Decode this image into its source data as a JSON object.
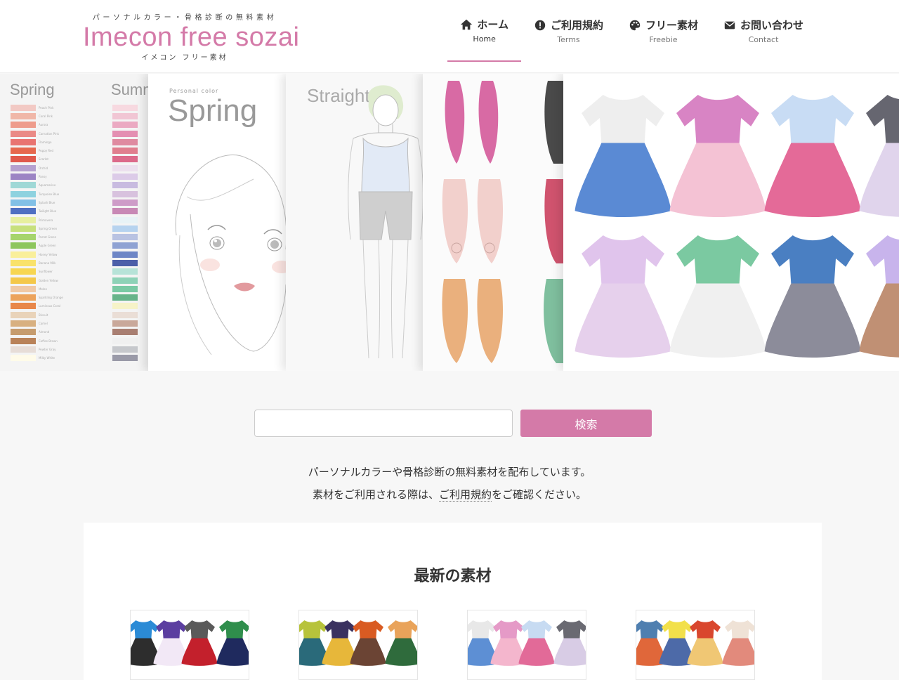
{
  "header": {
    "logo": {
      "tagline": "パーソナルカラー・骨格診断の無料素材",
      "title": "Imecon free sozai",
      "subtitle": "イメコン フリー素材"
    },
    "nav": [
      {
        "label": "ホーム",
        "sub": "Home",
        "icon": "home-icon",
        "active": true
      },
      {
        "label": "ご利用規約",
        "sub": "Terms",
        "icon": "exclamation-circle-icon",
        "active": false
      },
      {
        "label": "フリー素材",
        "sub": "Freebie",
        "icon": "palette-icon",
        "active": false
      },
      {
        "label": "お問い合わせ",
        "sub": "Contact",
        "icon": "envelope-icon",
        "active": false
      }
    ]
  },
  "hero": {
    "swatch_titles": [
      "Spring",
      "Summ"
    ],
    "spring_swatches": [
      "#f2c9c4",
      "#f0b7a8",
      "#ee9c8c",
      "#ea8a86",
      "#e97471",
      "#e6684e",
      "#e0594c",
      "#b5a0cf",
      "#9c84c4",
      "#9fd8d6",
      "#8ed2df",
      "#82c0e6",
      "#4f6fc2",
      "#e7ef9f",
      "#c7e07c",
      "#a6d46c",
      "#8dc65d",
      "#f9ef9a",
      "#f9e26b",
      "#f7d651",
      "#f4c84a",
      "#f0c9a6",
      "#eca35c",
      "#e8874a",
      "#e9d3b9",
      "#d8b080",
      "#c69c6e",
      "#b98258",
      "#e7ddd7",
      "#fffbe9"
    ],
    "spring_labels": [
      "Peach Pink",
      "Coral Pink",
      "Aurora",
      "Carnation Pink",
      "Flamingo",
      "Poppy Red",
      "Scarlet",
      "Orchid",
      "Pansy",
      "Aquamarine",
      "Turquoise Blue",
      "Splash Blue",
      "Twilight Blue",
      "Primavera",
      "Spring Green",
      "Parrot Green",
      "Apple Green",
      "Honey Yellow",
      "Banana Milk",
      "Sunflower",
      "Golden Yellow",
      "Melon",
      "Sparkling Orange",
      "Luminous Coral",
      "Biscuit",
      "Camel",
      "Almond",
      "Coffee Brown",
      "Pewter Gray",
      "Milky White"
    ],
    "summer_swatches": [
      "#f7d9e0",
      "#f1c6d4",
      "#eba9c2",
      "#e48fb2",
      "#df8aa0",
      "#e07e8e",
      "#dc6a8a",
      "#ece0ee",
      "#dccbe8",
      "#c8bbe0",
      "#d8c2de",
      "#ce9cc8",
      "#c889b5",
      "#e8f3f6",
      "#b6d3ef",
      "#b9c3e2",
      "#8fa2d3",
      "#6e86c6",
      "#4c5fa9",
      "#b7e3d8",
      "#8ed2b7",
      "#7ac9a4",
      "#67b48a",
      "#f6f3c8",
      "#eaded6",
      "#c9a89a",
      "#a97f72",
      "#f0f0f0",
      "#c6c8cc",
      "#9a9aa8"
    ],
    "face_small": "Personal color",
    "face_title": "Spring",
    "body_title": "Straight"
  },
  "search": {
    "placeholder": "",
    "button_label": "検索"
  },
  "intro": {
    "line1": "パーソナルカラーや骨格診断の無料素材を配布しています。",
    "line2_before": "素材をご利用される際は、",
    "line2_link": "ご利用規約",
    "line2_after": "をご確認ください。"
  },
  "latest": {
    "title": "最新の素材",
    "cards": [
      {
        "tops": [
          "#2b8bd6",
          "#5b3ea0",
          "#5a5a5a",
          "#2f8e4c"
        ],
        "skirts": [
          "#2d2d2d",
          "#f2e8f6",
          "#c3202c",
          "#1f2a5e"
        ]
      },
      {
        "tops": [
          "#b7c33b",
          "#3a3260",
          "#d95b22",
          "#e9a35a"
        ],
        "skirts": [
          "#2a6a7a",
          "#e7b73a",
          "#6b4434",
          "#2f6b3c"
        ]
      },
      {
        "tops": [
          "#e8e8e8",
          "#e59ac7",
          "#c7dbf2",
          "#6a6a72"
        ],
        "skirts": [
          "#5d8fd4",
          "#f4b6cd",
          "#e26a98",
          "#d8cce5"
        ]
      },
      {
        "tops": [
          "#4f7fb0",
          "#f2e04a",
          "#d9472e",
          "#efe2d6"
        ],
        "skirts": [
          "#e0673a",
          "#4d6aa8",
          "#f0c774",
          "#e28a7c"
        ]
      }
    ]
  },
  "colors": {
    "accent": "#d47aa8",
    "header_bg": "#ffffff",
    "page_bg": "#f7f7f7"
  }
}
